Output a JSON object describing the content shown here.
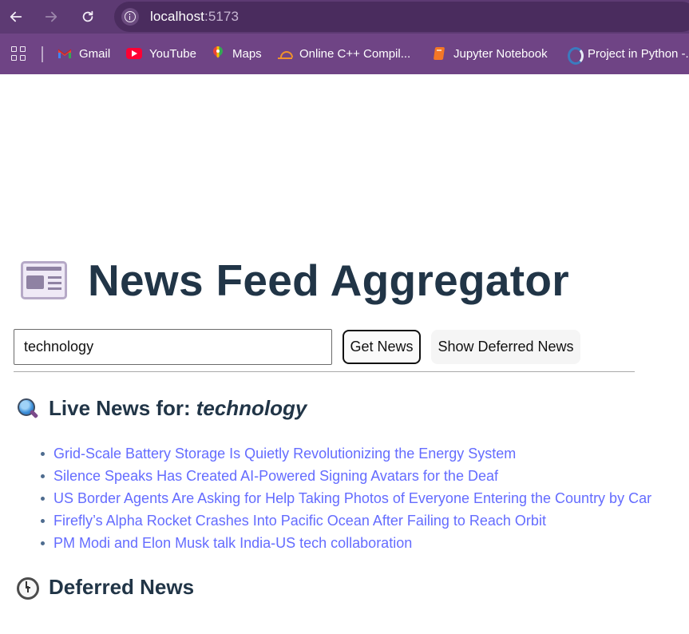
{
  "browser": {
    "url_host": "localhost",
    "url_port": ":5173",
    "bookmarks": [
      {
        "label": "Gmail",
        "icon": "gmail-icon"
      },
      {
        "label": "YouTube",
        "icon": "youtube-icon"
      },
      {
        "label": "Maps",
        "icon": "maps-icon"
      },
      {
        "label": "Online C++ Compil...",
        "icon": "sunrise-icon"
      },
      {
        "label": "Jupyter Notebook",
        "icon": "jupyter-icon"
      },
      {
        "label": "Project in Python -...",
        "icon": "python-icon"
      }
    ]
  },
  "header": {
    "title": "News Feed Aggregator",
    "icon": "newspaper-icon"
  },
  "search": {
    "value": "technology",
    "get_news_label": "Get News",
    "show_deferred_label": "Show Deferred News"
  },
  "live": {
    "icon": "magnifier-icon",
    "heading": "Live News for:",
    "topic": "technology",
    "items": [
      "Grid-Scale Battery Storage Is Quietly Revolutionizing the Energy System",
      "Silence Speaks Has Created AI-Powered Signing Avatars for the Deaf",
      "US Border Agents Are Asking for Help Taking Photos of Everyone Entering the Country by Car",
      "Firefly’s Alpha Rocket Crashes Into Pacific Ocean After Failing to Reach Orbit",
      "PM Modi and Elon Musk talk India-US tech collaboration"
    ]
  },
  "deferred": {
    "icon": "clock-icon",
    "heading": "Deferred News"
  }
}
